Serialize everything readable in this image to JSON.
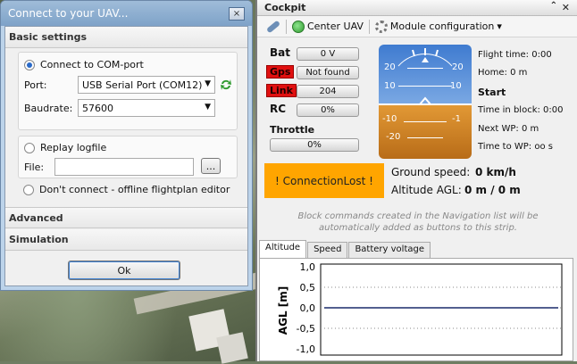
{
  "dialog": {
    "title": "Connect to your UAV...",
    "close_glyph": "×",
    "basic_settings": "Basic settings",
    "connect_com": "Connect to COM-port",
    "port_label": "Port:",
    "port_value": "USB Serial Port (COM12)",
    "baudrate_label": "Baudrate:",
    "baudrate_value": "57600",
    "replay_logfile": "Replay logfile",
    "file_label": "File:",
    "file_value": "",
    "browse_label": "...",
    "dont_connect": "Don't connect - offline flightplan editor",
    "advanced": "Advanced",
    "simulation": "Simulation",
    "ok": "Ok"
  },
  "cockpit": {
    "title": "Cockpit",
    "toolbar": {
      "center_uav": "Center UAV",
      "module_config": "Module configuration",
      "dropdown": "▾"
    },
    "stats": [
      {
        "label": "Bat",
        "value": "0 V",
        "alert": false
      },
      {
        "label": "Gps",
        "value": "Not found",
        "alert": true
      },
      {
        "label": "Link",
        "value": "204",
        "alert": true
      },
      {
        "label": "RC",
        "value": "0%",
        "alert": false
      }
    ],
    "throttle_label": "Throttle",
    "throttle_value": "0%",
    "horizon_numbers": [
      "20",
      "20",
      "10",
      "10",
      "-10",
      "-1",
      "-20"
    ],
    "right_info": {
      "flight_time": "Flight time: 0:00",
      "home": "Home: 0 m",
      "start": "Start",
      "time_in_block": "Time in block: 0:00",
      "next_wp": "Next WP: 0 m",
      "time_to_wp": "Time to WP: oo s"
    },
    "connection_lost": "! ConnectionLost !",
    "ground_speed_label": "Ground speed:",
    "ground_speed_value": "0 km/h",
    "altitude_label": "Altitude AGL:",
    "altitude_value": "0 m / 0 m",
    "note": "Block commands created in the Navigation list will be automatically added as buttons to this strip.",
    "tabs": [
      "Altitude",
      "Speed",
      "Battery voltage"
    ]
  },
  "chart_data": {
    "type": "line",
    "ylabel": "AGL [m]",
    "ylim": [
      -1.0,
      1.0
    ],
    "yticks": [
      "1,0",
      "0,5",
      "0,0",
      "-0,5",
      "-1,0"
    ],
    "series": [
      {
        "values": [
          0,
          0
        ]
      }
    ],
    "grid": true
  }
}
